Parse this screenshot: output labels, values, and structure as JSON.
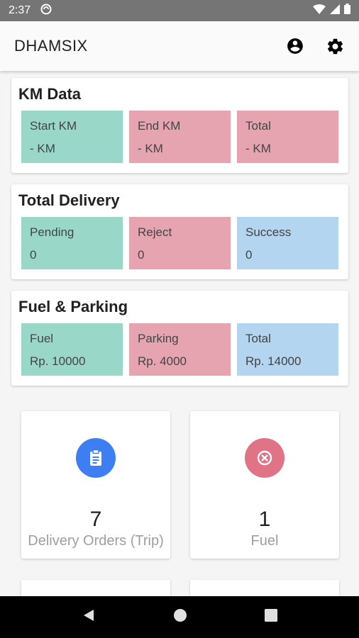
{
  "status_bar": {
    "time": "2:37"
  },
  "app_bar": {
    "title": "DHAMSIX"
  },
  "km_data": {
    "title": "KM Data",
    "start_label": "Start KM",
    "start_value": "- KM",
    "end_label": "End KM",
    "end_value": "- KM",
    "total_label": "Total",
    "total_value": "- KM"
  },
  "total_delivery": {
    "title": "Total Delivery",
    "pending_label": "Pending",
    "pending_value": "0",
    "reject_label": "Reject",
    "reject_value": "0",
    "success_label": "Success",
    "success_value": "0"
  },
  "fuel_parking": {
    "title": "Fuel & Parking",
    "fuel_label": "Fuel",
    "fuel_value": "Rp. 10000",
    "parking_label": "Parking",
    "parking_value": "Rp. 4000",
    "total_label": "Total",
    "total_value": "Rp. 14000"
  },
  "stats": {
    "orders": {
      "value": "7",
      "label": "Delivery Orders (Trip)",
      "icon": "clipboard-icon"
    },
    "fuel": {
      "value": "1",
      "label": "Fuel",
      "icon": "cancel-icon"
    }
  },
  "colors": {
    "green_tile": "#99d8c9",
    "red_tile": "#e6a4b1",
    "blue_tile": "#b3d5ef",
    "orders_icon_bg": "#3d7ef2",
    "fuel_icon_bg": "#e07385"
  }
}
